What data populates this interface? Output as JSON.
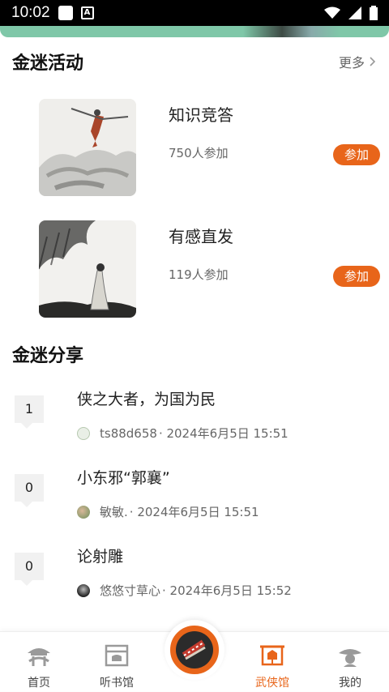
{
  "status_bar": {
    "time": "10:02"
  },
  "activities_section": {
    "title": "金迷活动",
    "more_label": "更多",
    "items": [
      {
        "title": "知识竞答",
        "count": "750人参加",
        "join_label": "参加"
      },
      {
        "title": "有感直发",
        "count": "119人参加",
        "join_label": "参加"
      }
    ]
  },
  "share_section": {
    "title": "金迷分享",
    "items": [
      {
        "count": "1",
        "title": "侠之大者，为国为民",
        "author": "ts88d658",
        "time": "· 2024年6月5日 15:51"
      },
      {
        "count": "0",
        "title": "小东邪“郭襄”",
        "author": "敏敏.",
        "time": "· 2024年6月5日 15:51"
      },
      {
        "count": "0",
        "title": "论射雕",
        "author": "悠悠寸草心",
        "time": "· 2024年6月5日 15:52"
      }
    ]
  },
  "tab_bar": {
    "tabs": [
      {
        "label": "首页"
      },
      {
        "label": "听书馆"
      },
      {
        "label": "武侠馆"
      },
      {
        "label": "我的"
      }
    ]
  },
  "colors": {
    "accent": "#e8651a",
    "badge_bg": "#f1f1f1",
    "banner": "#7fc7a8"
  }
}
